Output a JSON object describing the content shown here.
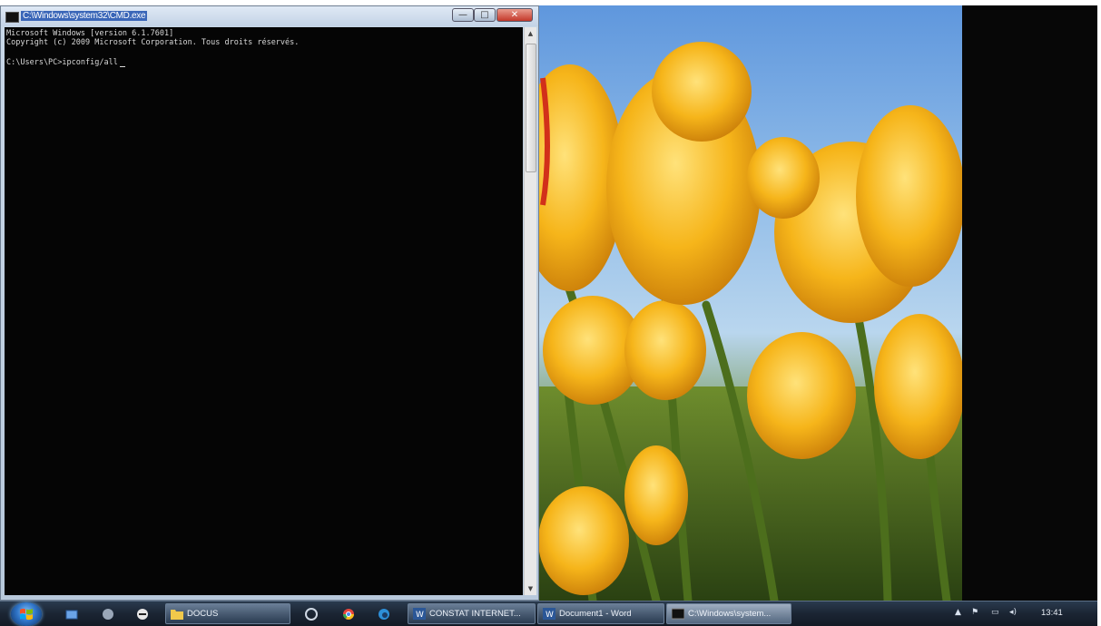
{
  "cmd_window": {
    "title": "C:\\Windows\\system32\\CMD.exe",
    "console_lines": [
      "Microsoft Windows [version 6.1.7601]",
      "Copyright (c) 2009 Microsoft Corporation. Tous droits réservés.",
      "",
      "C:\\Users\\PC>ipconfig/all"
    ],
    "buttons": {
      "minimize": "—",
      "maximize": "□",
      "close": "✕"
    }
  },
  "taskbar": {
    "start": "start-orb",
    "quick_launch": [
      "explorer-icon",
      "media-icon",
      "game-icon"
    ],
    "pinned": [
      "ie-icon",
      "chrome-icon",
      "edge-icon"
    ],
    "items": [
      {
        "label": "DOCUS",
        "icon": "folder-icon"
      },
      {
        "label": "CONSTAT INTERNET...",
        "icon": "word-icon"
      },
      {
        "label": "Document1 - Word",
        "icon": "word-icon"
      },
      {
        "label": "C:\\Windows\\system...",
        "icon": "cmd-icon"
      }
    ],
    "tray": {
      "clock": "13:41"
    }
  },
  "colors": {
    "console_bg": "#050505",
    "console_text": "#d8d8d8",
    "taskbar": "#1b2533",
    "tulip": "#f4b21b",
    "sky": "#6fa3e0"
  }
}
